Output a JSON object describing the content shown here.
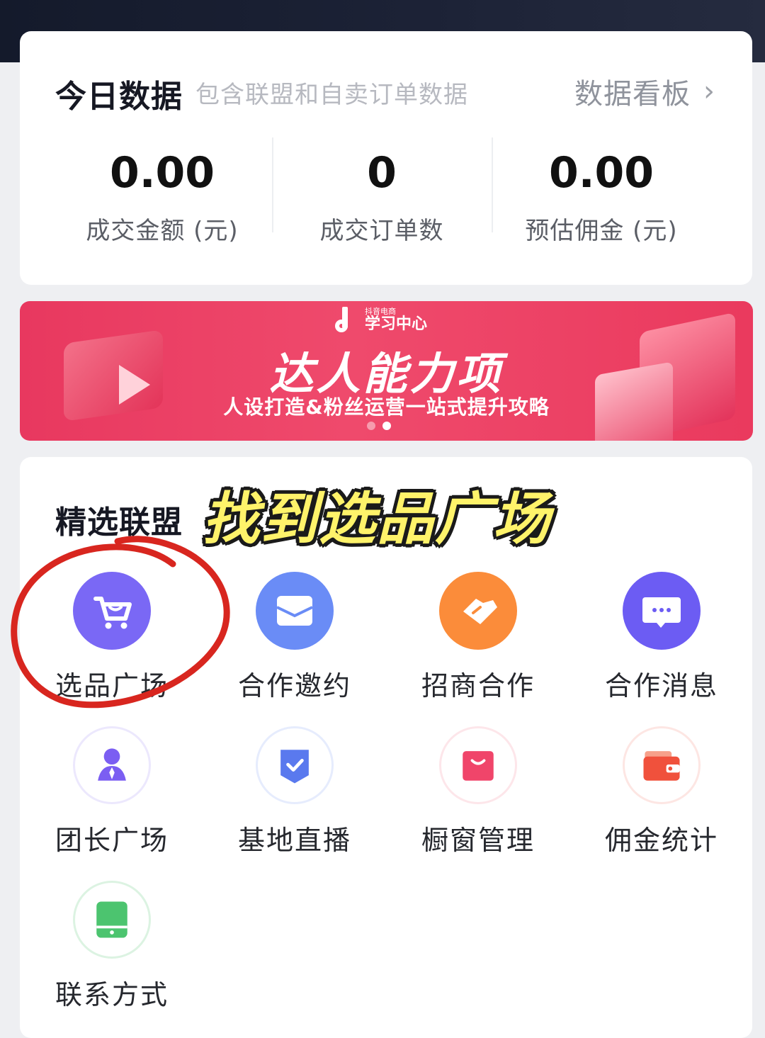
{
  "today": {
    "title": "今日数据",
    "subtitle": "包含联盟和自卖订单数据",
    "dashboard_link": "数据看板",
    "stats": [
      {
        "value": "0.00",
        "label": "成交金额 (元)"
      },
      {
        "value": "0",
        "label": "成交订单数"
      },
      {
        "value": "0.00",
        "label": "预估佣金 (元)"
      }
    ]
  },
  "banner": {
    "brand_small": "抖音电商",
    "brand_main": "学习中心",
    "title": "达人能力项",
    "subtitle": "人设打造&粉丝运营一站式提升攻略",
    "page_count": 2,
    "active_page": 2
  },
  "alliance": {
    "title": "精选联盟",
    "overlay_caption": "找到选品广场",
    "items": [
      {
        "label": "选品广场",
        "icon": "cart-icon"
      },
      {
        "label": "合作邀约",
        "icon": "envelope-icon"
      },
      {
        "label": "招商合作",
        "icon": "handshake-icon"
      },
      {
        "label": "合作消息",
        "icon": "chat-icon"
      },
      {
        "label": "团长广场",
        "icon": "person-icon"
      },
      {
        "label": "基地直播",
        "icon": "shield-check-icon"
      },
      {
        "label": "橱窗管理",
        "icon": "shopping-bag-icon"
      },
      {
        "label": "佣金统计",
        "icon": "wallet-icon"
      },
      {
        "label": "联系方式",
        "icon": "phone-icon"
      }
    ]
  },
  "colors": {
    "banner": "#e8385f",
    "overlay_text": "#fff36a",
    "annotation_circle": "#d8261f"
  }
}
